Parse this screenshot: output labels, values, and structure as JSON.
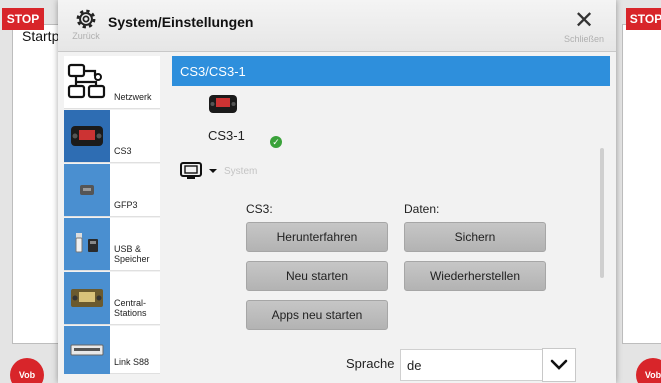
{
  "background": {
    "stop_left": "STOP",
    "stop_right": "STOP",
    "startpage_label": "Startp",
    "logo_left": "Vob",
    "logo_right": "Vob"
  },
  "titlebar": {
    "title": "System/Einstellungen",
    "back_label": "Zurück",
    "close_label": "Schließen"
  },
  "sidebar": {
    "items": [
      {
        "label": "Netzwerk"
      },
      {
        "label": "CS3"
      },
      {
        "label": "GFP3"
      },
      {
        "label": "USB &\nSpeicher"
      },
      {
        "label": "Central-\nStations"
      },
      {
        "label": "Link S88"
      }
    ]
  },
  "device": {
    "header": "CS3/CS3-1",
    "name": "CS3-1",
    "system_label": "System"
  },
  "sections": {
    "cs3_label": "CS3:",
    "daten_label": "Daten:"
  },
  "buttons": {
    "shutdown": "Herunterfahren",
    "backup": "Sichern",
    "restart": "Neu starten",
    "restore": "Wiederherstellen",
    "restart_apps": "Apps neu starten"
  },
  "language": {
    "label": "Sprache",
    "value": "de"
  },
  "colors": {
    "accent": "#2e8fdc",
    "stop": "#d8252a",
    "ok": "#3aa23a"
  }
}
